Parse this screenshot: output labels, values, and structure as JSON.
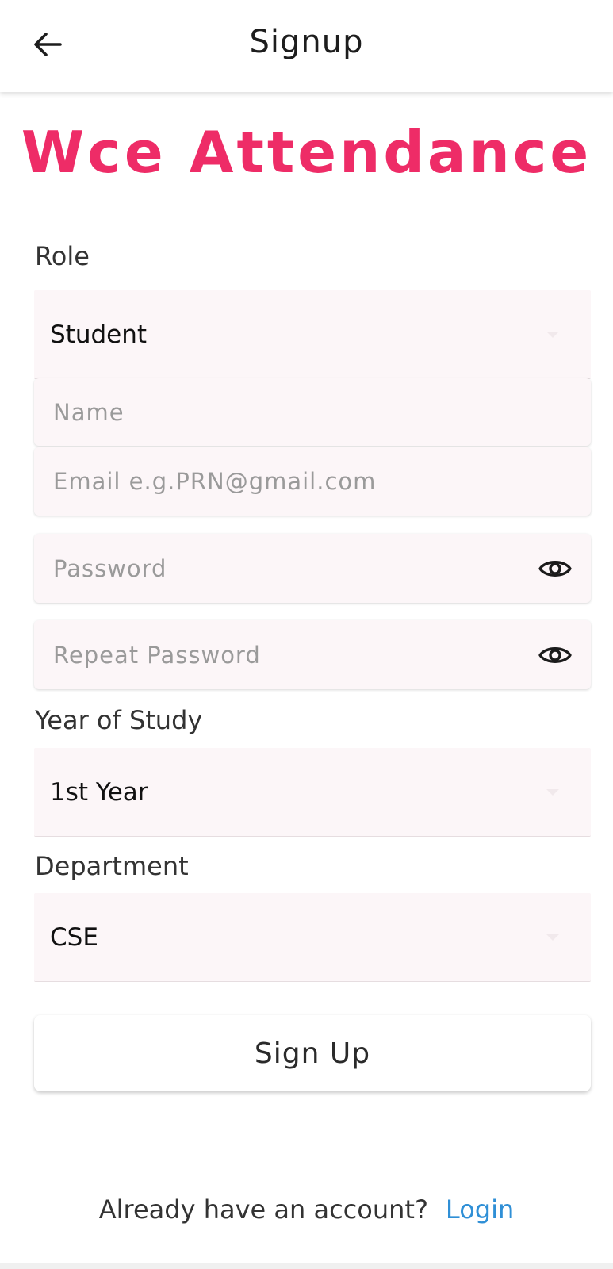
{
  "appbar": {
    "title": "Signup",
    "back_icon": "arrow-left-icon"
  },
  "brand": {
    "title": "Wce Attendance",
    "color": "#ee2c67"
  },
  "form": {
    "role": {
      "label": "Role",
      "value": "Student"
    },
    "name": {
      "placeholder": "Name"
    },
    "email": {
      "placeholder": "Email e.g.PRN@gmail.com"
    },
    "password": {
      "placeholder": "Password",
      "icon": "eye-icon"
    },
    "repeat_password": {
      "placeholder": "Repeat Password",
      "icon": "eye-icon"
    },
    "year": {
      "label": "Year of Study",
      "value": "1st Year"
    },
    "department": {
      "label": "Department",
      "value": "CSE"
    },
    "field_background": "#fcf6f8"
  },
  "signup_button": {
    "label": "Sign Up"
  },
  "footer": {
    "prompt": "Already have an account?",
    "login_link": "Login",
    "link_color": "#2f8fd6"
  }
}
